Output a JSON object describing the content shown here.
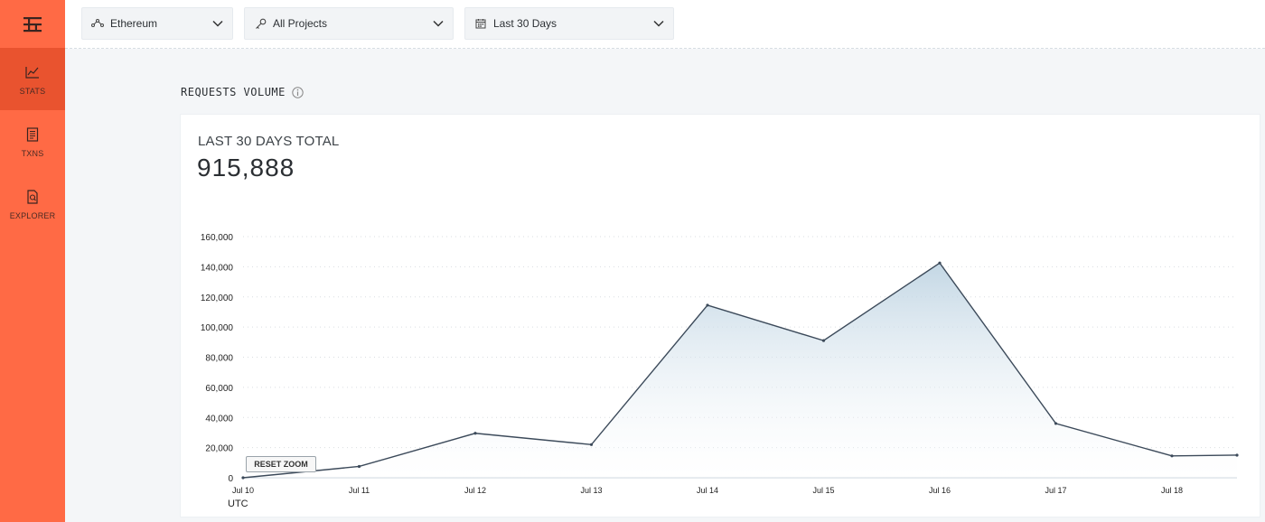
{
  "sidebar": {
    "items": [
      {
        "label": "STATS",
        "icon": "stats-chart-icon",
        "active": true
      },
      {
        "label": "TXNS",
        "icon": "receipt-icon",
        "active": false
      },
      {
        "label": "EXPLORER",
        "icon": "document-search-icon",
        "active": false
      }
    ]
  },
  "topbar": {
    "network": {
      "value": "Ethereum",
      "icon": "network-nodes-icon"
    },
    "project": {
      "value": "All Projects",
      "icon": "key-icon"
    },
    "range": {
      "value": "Last 30 Days",
      "icon": "calendar-icon"
    }
  },
  "main": {
    "section_title": "REQUESTS VOLUME",
    "card": {
      "total_label": "LAST 30 DAYS TOTAL",
      "total_value": "915,888",
      "reset_zoom": "RESET ZOOM",
      "timezone": "UTC"
    }
  },
  "colors": {
    "accent": "#ff6a45",
    "accent_dark": "#e9532f",
    "line": "#3c4a5a",
    "fill": "#b9d0e0"
  },
  "chart_data": {
    "type": "area",
    "x": [
      "Jul 10",
      "Jul 11",
      "Jul 12",
      "Jul 13",
      "Jul 14",
      "Jul 15",
      "Jul 16",
      "Jul 17",
      "Jul 18",
      "Jul 18 end"
    ],
    "x_tick_labels": [
      "Jul 10",
      "Jul 11",
      "Jul 12",
      "Jul 13",
      "Jul 14",
      "Jul 15",
      "Jul 16",
      "Jul 17",
      "Jul 18"
    ],
    "values": [
      0,
      7500,
      29500,
      22000,
      114500,
      91000,
      142500,
      36000,
      14500,
      15000
    ],
    "ylim": [
      0,
      160000
    ],
    "y_ticks": [
      "0",
      "20,000",
      "40,000",
      "60,000",
      "80,000",
      "100,000",
      "120,000",
      "140,000",
      "160,000"
    ],
    "grid": true,
    "xlabel": "UTC"
  }
}
